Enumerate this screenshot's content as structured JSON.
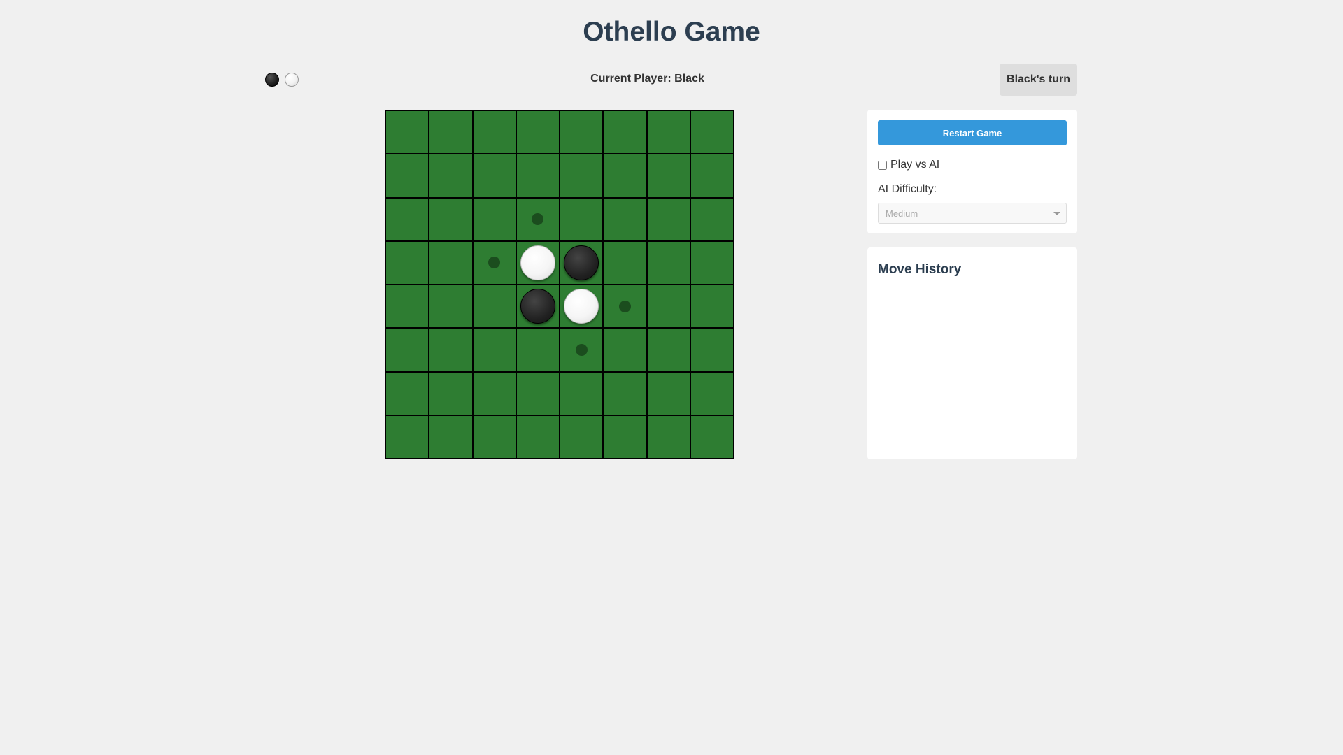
{
  "title": "Othello Game",
  "header": {
    "current_player_text": "Current Player: Black",
    "turn_indicator": "Black's turn",
    "piece_icons": [
      "black-disc",
      "white-disc"
    ]
  },
  "board": {
    "size": 8,
    "cell_color": "#2e7d32",
    "grid_color": "#000000",
    "hint_color": "#1b4d1e",
    "discs": [
      {
        "row": 3,
        "col": 3,
        "color": "white"
      },
      {
        "row": 3,
        "col": 4,
        "color": "black"
      },
      {
        "row": 4,
        "col": 3,
        "color": "black"
      },
      {
        "row": 4,
        "col": 4,
        "color": "white"
      }
    ],
    "valid_moves": [
      {
        "row": 2,
        "col": 3
      },
      {
        "row": 3,
        "col": 2
      },
      {
        "row": 4,
        "col": 5
      },
      {
        "row": 5,
        "col": 4
      }
    ]
  },
  "controls": {
    "restart_label": "Restart Game",
    "play_vs_ai_label": "Play vs AI",
    "play_vs_ai_checked": false,
    "difficulty_label": "AI Difficulty:",
    "difficulty_value": "Medium",
    "difficulty_disabled": true
  },
  "history": {
    "title": "Move History",
    "moves": []
  },
  "colors": {
    "accent": "#3498db",
    "heading": "#2c3e50",
    "background": "#f0f0f0"
  }
}
